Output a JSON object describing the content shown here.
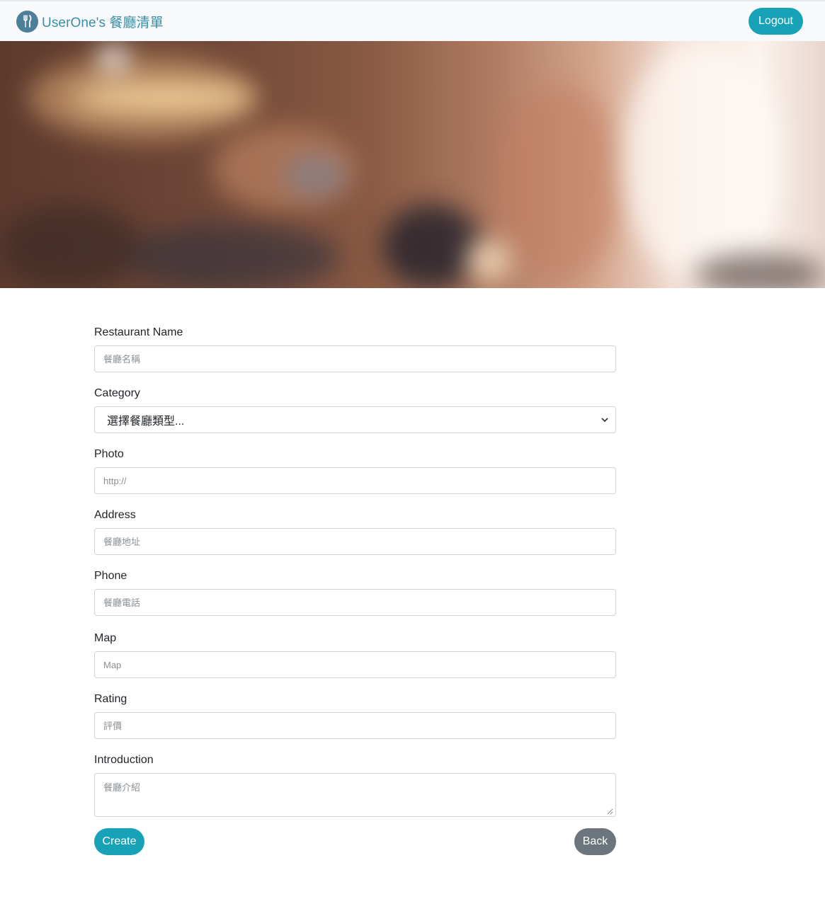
{
  "navbar": {
    "brand": "UserOne's 餐廳清單",
    "logout_label": "Logout"
  },
  "form": {
    "fields": [
      {
        "label": "Restaurant Name",
        "placeholder": "餐廳名稱"
      },
      {
        "label": "Category",
        "selected": "選擇餐廳類型..."
      },
      {
        "label": "Photo",
        "placeholder": "http://"
      },
      {
        "label": "Address",
        "placeholder": "餐廳地址"
      },
      {
        "label": "Phone",
        "placeholder": "餐廳電話"
      },
      {
        "label": "Map",
        "placeholder": "Map"
      },
      {
        "label": "Rating",
        "placeholder": "評價"
      },
      {
        "label": "Introduction",
        "placeholder": "餐廳介紹"
      }
    ],
    "create_label": "Create",
    "back_label": "Back"
  },
  "colors": {
    "primary": "#17a2b8",
    "secondary": "#6c757d",
    "brand_text": "#3a8ea8",
    "navbar_bg": "#f8f9fa"
  }
}
